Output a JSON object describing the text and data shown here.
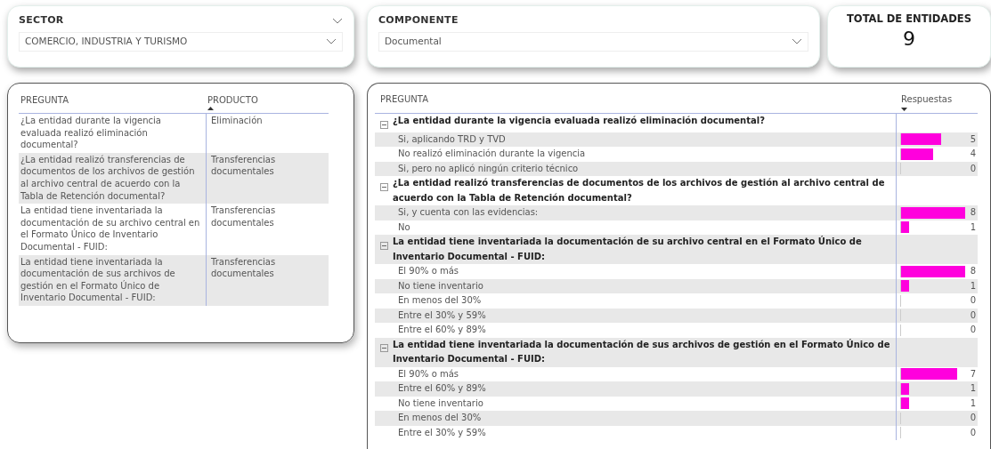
{
  "filters": [
    {
      "label": "SECTOR",
      "value": "COMERCIO, INDUSTRIA Y TURISMO",
      "kind": "header-caret"
    },
    {
      "label": "COMPONENTE",
      "value": "Documental",
      "kind": "plain"
    }
  ],
  "total_card": {
    "title": "TOTAL DE ENTIDADES",
    "value": "9"
  },
  "product_table": {
    "columns": [
      {
        "label": "PREGUNTA",
        "sorted": false
      },
      {
        "label": "PRODUCTO",
        "sorted": true,
        "ascending": true
      }
    ],
    "rows": [
      {
        "pregunta": "¿La entidad durante la vigencia evaluada realizó eliminación documental?",
        "producto": "Eliminación"
      },
      {
        "pregunta": "¿La entidad realizó transferencias de documentos de los archivos de gestión al archivo central de acuerdo con la Tabla de Retención documental?",
        "producto": "Transferencias documentales"
      },
      {
        "pregunta": "La entidad tiene inventariada la documentación de su archivo central en el Formato Único de Inventario Documental - FUID:",
        "producto": "Transferencias documentales"
      },
      {
        "pregunta": "La entidad tiene inventariada la documentación de sus archivos de gestión en el Formato Único de Inventario Documental - FUID:",
        "producto": "Transferencias documentales"
      }
    ]
  },
  "answers_matrix": {
    "columns": [
      {
        "label": "PREGUNTA",
        "sorted": false
      },
      {
        "label": "Respuestas",
        "sorted": true,
        "ascending": false
      }
    ],
    "groups": [
      {
        "label": "¿La entidad durante la vigencia evaluada realizó eliminación documental?",
        "expanded": true,
        "children": [
          {
            "label": "Si, aplicando TRD y TVD",
            "level": 0.625,
            "reading": "5"
          },
          {
            "label": "No realizó eliminación durante la vigencia",
            "level": 0.5,
            "reading": "4"
          },
          {
            "label": "Si, pero no aplicó ningún criterio técnico",
            "level": 0,
            "reading": "0"
          }
        ]
      },
      {
        "label": "¿La entidad realizó transferencias de documentos de los archivos de gestión al archivo central de acuerdo con la Tabla de Retención documental?",
        "expanded": true,
        "children": [
          {
            "label": "Si, y cuenta con las evidencias:",
            "level": 1,
            "reading": "8"
          },
          {
            "label": "No",
            "level": 0.125,
            "reading": "1"
          }
        ]
      },
      {
        "label": "La entidad tiene inventariada la documentación de su archivo central en el Formato Único de Inventario Documental - FUID:",
        "expanded": true,
        "children": [
          {
            "label": "El 90% o más",
            "level": 1,
            "reading": "8"
          },
          {
            "label": "No tiene inventario",
            "level": 0.125,
            "reading": "1"
          },
          {
            "label": "En menos del 30%",
            "level": 0,
            "reading": "0"
          },
          {
            "label": "Entre el 30% y 59%",
            "level": 0,
            "reading": "0"
          },
          {
            "label": "Entre el 60% y 89%",
            "level": 0,
            "reading": "0"
          }
        ]
      },
      {
        "label": "La entidad tiene inventariada la documentación de sus archivos de gestión en el Formato Único de Inventario Documental - FUID:",
        "expanded": true,
        "children": [
          {
            "label": "El 90% o más",
            "level": 0.875,
            "reading": "7"
          },
          {
            "label": "Entre el 60% y 89%",
            "level": 0.125,
            "reading": "1"
          },
          {
            "label": "No tiene inventario",
            "level": 0.125,
            "reading": "1"
          },
          {
            "label": "En menos del 30%",
            "level": 0,
            "reading": "0"
          },
          {
            "label": "Entre el 30% y 59%",
            "level": 0,
            "reading": "0"
          }
        ]
      }
    ]
  }
}
